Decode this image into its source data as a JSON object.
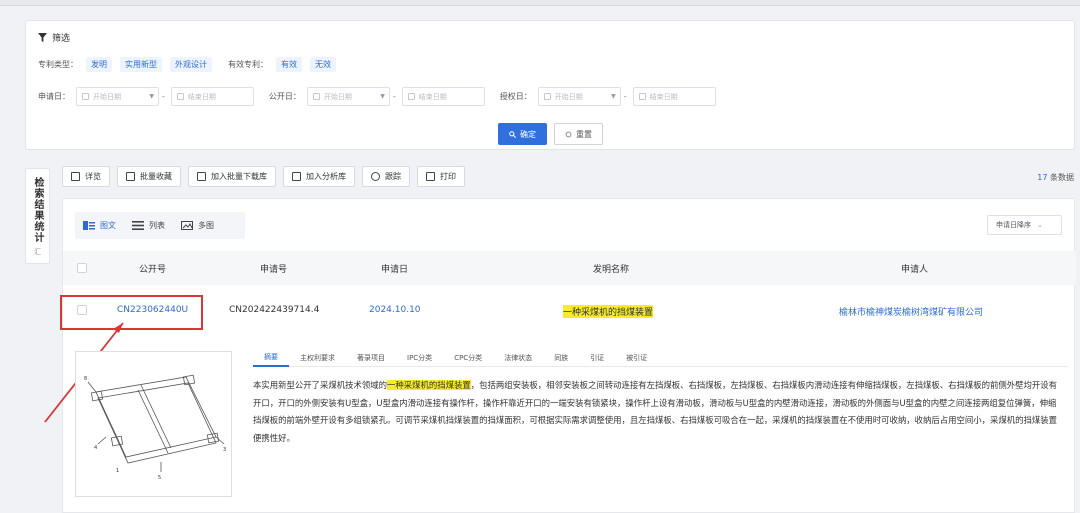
{
  "filter": {
    "title": "筛选",
    "patent_type_label": "专利类型：",
    "patent_types": [
      "发明",
      "实用新型",
      "外观设计"
    ],
    "valid_label": "有效专利：",
    "valid_options": [
      "有效",
      "无效"
    ],
    "apply_date_label": "申请日：",
    "publish_date_label": "公开日：",
    "grant_date_label": "授权日：",
    "start_placeholder": "开始日期",
    "end_placeholder": "结束日期",
    "confirm_label": "确定",
    "reset_label": "重置"
  },
  "sidebar": {
    "label": "检索结果统计",
    "sub": "汇"
  },
  "toolbar": {
    "buttons": [
      "详览",
      "批量收藏",
      "加入批量下载库",
      "加入分析库",
      "跟踪",
      "打印"
    ],
    "count_number": "17",
    "count_suffix": "条数据"
  },
  "views": {
    "items": [
      "图文",
      "列表",
      "多图"
    ],
    "sort_label": "申请日降序"
  },
  "table": {
    "headers": [
      "公开号",
      "申请号",
      "申请日",
      "发明名称",
      "申请人"
    ],
    "rows": [
      {
        "pub_no": "CN223062440U",
        "app_no": "CN202422439714.4",
        "app_date": "2024.10.10",
        "title": "一种采煤机的挡煤装置",
        "applicant": "榆林市榆神煤炭榆树湾煤矿有限公司"
      }
    ]
  },
  "detail": {
    "tabs": [
      "摘要",
      "主权利要求",
      "著录项目",
      "IPC分类",
      "CPC分类",
      "法律状态",
      "同族",
      "引证",
      "被引证"
    ],
    "abstract_prefix": "本实用新型公开了采煤机技术领域的",
    "abstract_highlight": "一种采煤机的挡煤装置",
    "abstract_rest": "，包括两组安装板，相邻安装板之间转动连接有左挡煤板、右挡煤板，左挡煤板、右挡煤板内滑动连接有伸缩挡煤板，左挡煤板、右挡煤板的前侧外壁均开设有开口，开口的外侧安装有U型盒，U型盒内滑动连接有操作杆，操作杆靠近开口的一端安装有锁紧块，操作杆上设有滑动板，滑动板与U型盒的内壁滑动连接，滑动板的外侧面与U型盒的内壁之间连接两组复位弹簧，伸缩挡煤板的前端外壁开设有多组锁紧孔。可调节采煤机挡煤装置的挡煤面积，可根据实际需求调整使用，且左挡煤板、右挡煤板可吸合在一起，采煤机的挡煤装置在不使用时可收纳，收纳后占用空间小，采煤机的挡煤装置便携性好。"
  },
  "colors": {
    "accent": "#2f6fde",
    "highlight": "#f6ec2a",
    "annotation": "#d93636"
  }
}
